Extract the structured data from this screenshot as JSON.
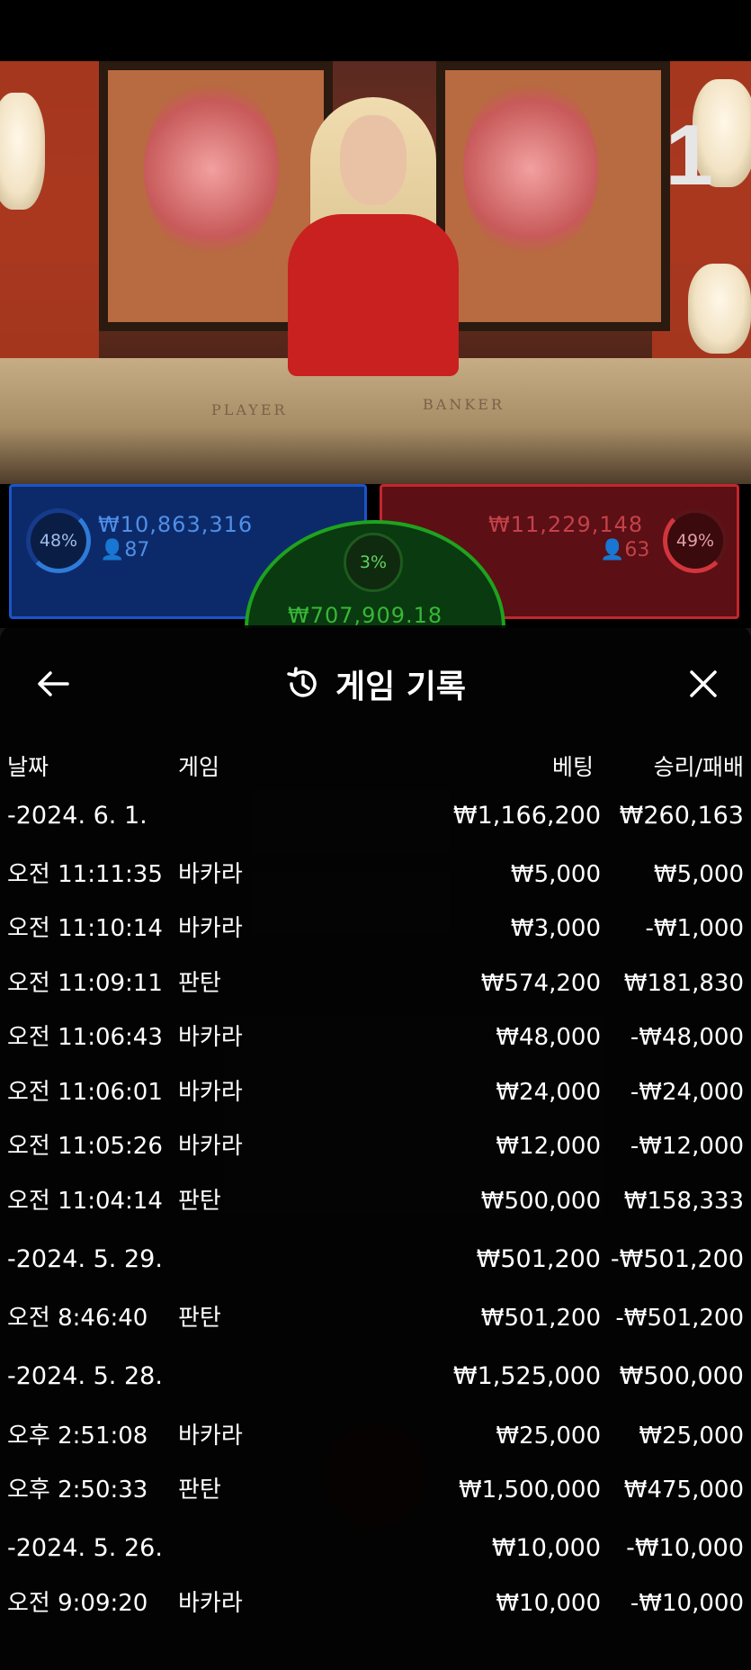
{
  "video": {
    "round_number": "1",
    "felt_player": "PLAYER",
    "felt_banker": "BANKER"
  },
  "betboard": {
    "player": {
      "percent": "48%",
      "amount": "₩10,863,316",
      "players": "87"
    },
    "banker": {
      "percent": "49%",
      "amount": "₩11,229,148",
      "players": "63"
    },
    "tie": {
      "percent": "3%",
      "amount": "₩707,909.18"
    }
  },
  "modal": {
    "title": "게임 기록",
    "columns": {
      "date": "날짜",
      "game": "게임",
      "bet": "베팅",
      "winloss": "승리/패배"
    },
    "rows": [
      {
        "type": "date",
        "time": "-2024. 6. 1.",
        "game": "",
        "bet": "₩1,166,200",
        "result": "₩260,163"
      },
      {
        "type": "entry",
        "time": "오전 11:11:35",
        "game": "바카라",
        "bet": "₩5,000",
        "result": "₩5,000"
      },
      {
        "type": "entry",
        "time": "오전 11:10:14",
        "game": "바카라",
        "bet": "₩3,000",
        "result": "-₩1,000"
      },
      {
        "type": "entry",
        "time": "오전 11:09:11",
        "game": "판탄",
        "bet": "₩574,200",
        "result": "₩181,830"
      },
      {
        "type": "entry",
        "time": "오전 11:06:43",
        "game": "바카라",
        "bet": "₩48,000",
        "result": "-₩48,000"
      },
      {
        "type": "entry",
        "time": "오전 11:06:01",
        "game": "바카라",
        "bet": "₩24,000",
        "result": "-₩24,000"
      },
      {
        "type": "entry",
        "time": "오전 11:05:26",
        "game": "바카라",
        "bet": "₩12,000",
        "result": "-₩12,000"
      },
      {
        "type": "entry",
        "time": "오전 11:04:14",
        "game": "판탄",
        "bet": "₩500,000",
        "result": "₩158,333"
      },
      {
        "type": "date",
        "time": "-2024. 5. 29.",
        "game": "",
        "bet": "₩501,200",
        "result": "-₩501,200"
      },
      {
        "type": "entry",
        "time": "오전 8:46:40",
        "game": "판탄",
        "bet": "₩501,200",
        "result": "-₩501,200"
      },
      {
        "type": "date",
        "time": "-2024. 5. 28.",
        "game": "",
        "bet": "₩1,525,000",
        "result": "₩500,000"
      },
      {
        "type": "entry",
        "time": "오후 2:51:08",
        "game": "바카라",
        "bet": "₩25,000",
        "result": "₩25,000"
      },
      {
        "type": "entry",
        "time": "오후 2:50:33",
        "game": "판탄",
        "bet": "₩1,500,000",
        "result": "₩475,000"
      },
      {
        "type": "date",
        "time": "-2024. 5. 26.",
        "game": "",
        "bet": "₩10,000",
        "result": "-₩10,000"
      },
      {
        "type": "entry",
        "time": "오전 9:09:20",
        "game": "바카라",
        "bet": "₩10,000",
        "result": "-₩10,000"
      }
    ]
  },
  "icons": {
    "back": "arrow-left-icon",
    "history": "history-clock-icon",
    "close": "close-x-icon",
    "user": "user-icon"
  },
  "colors": {
    "player_blue": "#1a54c8",
    "banker_red": "#c3262c",
    "tie_green": "#1fa21f"
  }
}
